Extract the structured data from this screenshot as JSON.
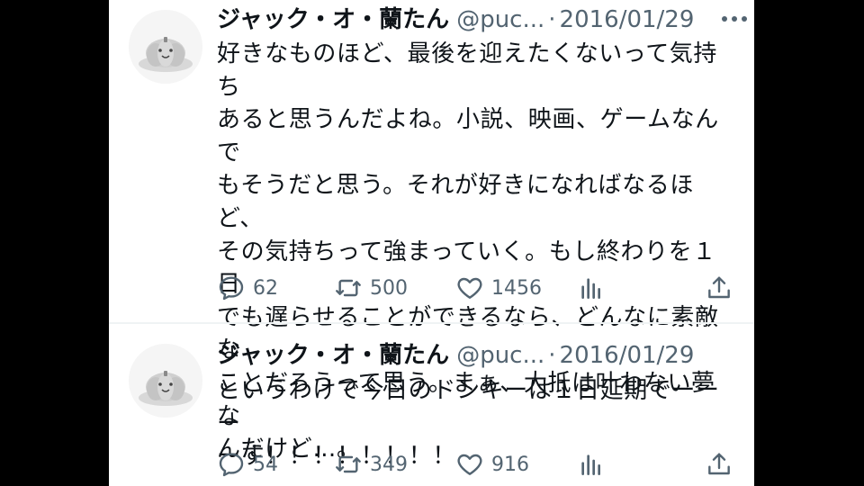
{
  "tweets": [
    {
      "display_name": "ジャック・オ・蘭たん",
      "handle": "@puc...",
      "separator": "·",
      "date": "2016/01/29",
      "text_lines": [
        "好きなものほど、最後を迎えたくないって気持ち",
        "あると思うんだよね。小説、映画、ゲームなんで",
        "もそうだと思う。それが好きになればなるほど、",
        "その気持ちって強まっていく。もし終わりを１日",
        "でも遅らせることができるなら、どんなに素敵な",
        "ことだろうって思う。まぁ、大抵は叶わない夢な",
        "んだけど…。"
      ],
      "reply_count": "62",
      "retweet_count": "500",
      "like_count": "1456"
    },
    {
      "display_name": "ジャック・オ・蘭たん",
      "handle": "@puc...",
      "separator": "·",
      "date": "2016/01/29",
      "text_lines": [
        "というわけで今日のドンキーは１日延期でーーー",
        "ーす！！！！！！！！"
      ],
      "reply_count": "54",
      "retweet_count": "349",
      "like_count": "916"
    }
  ],
  "icons": {
    "avatar": "pumpkin-avatar",
    "more": "more-icon",
    "reply": "reply-icon",
    "retweet": "retweet-icon",
    "like": "heart-icon",
    "views": "views-icon",
    "share": "share-icon"
  },
  "colors": {
    "text_primary": "#0f1419",
    "text_secondary": "#536471",
    "divider": "#eff3f4",
    "background_outer": "#000000",
    "background_panel": "#ffffff"
  }
}
